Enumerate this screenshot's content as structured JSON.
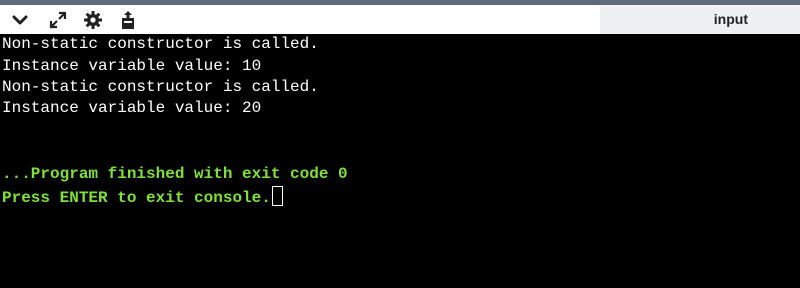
{
  "toolbar": {
    "icons": [
      "chevron-down-icon",
      "expand-icon",
      "gear-icon",
      "share-icon"
    ],
    "input_label": "input"
  },
  "console": {
    "output": [
      "Non-static constructor is called.",
      "Instance variable value: 10",
      "Non-static constructor is called.",
      "Instance variable value: 20"
    ],
    "finished_message": "...Program finished with exit code 0",
    "prompt": "Press ENTER to exit console."
  },
  "colors": {
    "output_text": "#ffffff",
    "status_text": "#7fe03a",
    "background": "#000000"
  }
}
